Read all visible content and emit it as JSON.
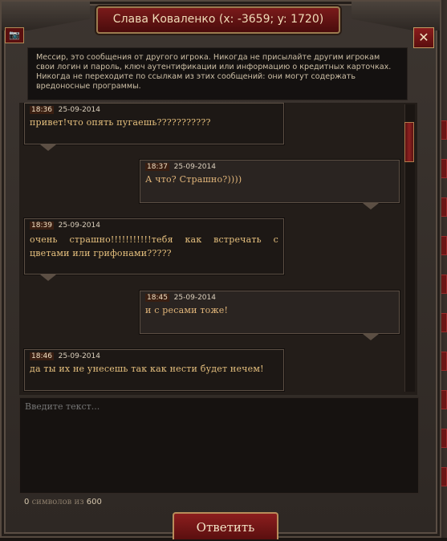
{
  "window": {
    "title": "Слава Коваленко (x: -3659; y: 1720)",
    "close_label": "✕",
    "camera_label": "📷"
  },
  "notice": "Мессир, это сообщения от другого игрока. Никогда не присылайте другим игрокам свои логин и пароль, ключ аутентификации или информацию о кредитных карточках. Никогда не переходите по ссылкам из этих сообщений: они могут содержать вредоносные программы.",
  "messages": [
    {
      "time": "18:36",
      "date": "25-09-2014",
      "text": "привет!что опять пугаешь???????????",
      "side": "left"
    },
    {
      "time": "18:37",
      "date": "25-09-2014",
      "text": "А что? Страшно?))))",
      "side": "right"
    },
    {
      "time": "18:39",
      "date": "25-09-2014",
      "text": "очень страшно!!!!!!!!!!!тебя как встречать с цветами или грифонами?????",
      "side": "left"
    },
    {
      "time": "18:45",
      "date": "25-09-2014",
      "text": "и с ресами тоже!",
      "side": "right"
    },
    {
      "time": "18:46",
      "date": "25-09-2014",
      "text": "да ты их не унесешь так как нести будет нечем!",
      "side": "left"
    }
  ],
  "input": {
    "placeholder": "Введите текст...",
    "count": "0",
    "count_label_1": "символов",
    "count_label_2": "из",
    "max": "600"
  },
  "reply_button": "Ответить",
  "colors": {
    "accent_red": "#7a1a1a",
    "gold_text": "#e6c07e"
  }
}
